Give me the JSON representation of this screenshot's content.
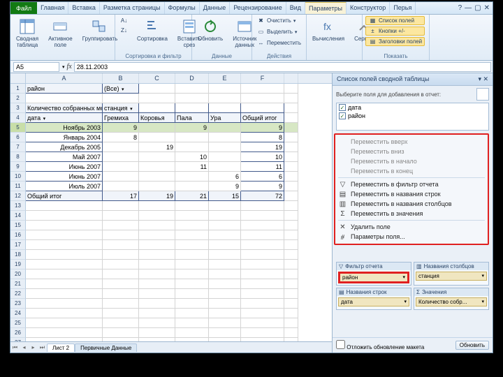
{
  "tabs": {
    "file": "Файл",
    "home": "Главная",
    "insert": "Вставка",
    "layout": "Разметка страницы",
    "formulas": "Формулы",
    "data": "Данные",
    "review": "Рецензирование",
    "view": "Вид",
    "options": "Параметры",
    "design": "Конструктор",
    "addon": "Перья"
  },
  "ribbon": {
    "g1": {
      "pivot": "Сводная\nтаблица",
      "active": "Активное\nполе",
      "group": "Группировать"
    },
    "g2": {
      "title": "Сортировка и фильтр",
      "sort": "Сортировка",
      "insert": "Вставить\nсрез"
    },
    "g3": {
      "title": "Данные",
      "refresh": "Обновить",
      "source": "Источник\nданных"
    },
    "g4": {
      "title": "Действия",
      "clear": "Очистить",
      "select": "Выделить",
      "move": "Переместить"
    },
    "g5": {
      "calc": "Вычисления",
      "tools": "Сервис"
    },
    "g6": {
      "title": "Показать",
      "fields": "Список полей",
      "buttons": "Кнопки +/-",
      "headers": "Заголовки полей"
    }
  },
  "fbar": {
    "name": "A5",
    "formula": "28.11.2003"
  },
  "grid": {
    "cols": [
      "A",
      "B",
      "C",
      "D",
      "E",
      "F"
    ],
    "a1": "район",
    "b1": "(Все)",
    "a3": "Количество собранных моллюсков",
    "b3": "станция",
    "a4": "дата",
    "b4": "Гремиха",
    "c4": "Коровья",
    "d4": "Пала",
    "e4": "Ура",
    "f4": "Общий итог",
    "r": [
      {
        "a": "Ноябрь 2003",
        "b": "9",
        "c": "",
        "d": "9",
        "e": "",
        "f": "9"
      },
      {
        "a": "Январь 2004",
        "b": "8",
        "c": "",
        "d": "",
        "e": "",
        "f": "8"
      },
      {
        "a": "Декабрь 2005",
        "b": "",
        "c": "19",
        "d": "",
        "e": "",
        "f": "19"
      },
      {
        "a": "Май 2007",
        "b": "",
        "c": "",
        "d": "10",
        "e": "",
        "f": "10"
      },
      {
        "a": "Июнь 2007",
        "b": "",
        "c": "",
        "d": "11",
        "e": "",
        "f": "11"
      },
      {
        "a": "Июнь 2007",
        "b": "",
        "c": "",
        "d": "",
        "e": "6",
        "f": "6"
      },
      {
        "a": "Июль 2007",
        "b": "",
        "c": "",
        "d": "",
        "e": "9",
        "f": "9"
      }
    ],
    "tot": {
      "a": "Общий итог",
      "b": "17",
      "c": "19",
      "d": "21",
      "e": "15",
      "f": "72"
    }
  },
  "sheets": {
    "s1": "Лист 2",
    "s2": "Первичные Данные"
  },
  "pane": {
    "title": "Список полей сводной таблицы",
    "sub": "Выберите поля для добавления в отчет:",
    "fields": {
      "f1": "дата",
      "f2": "район"
    },
    "menu": {
      "up": "Переместить вверх",
      "down": "Переместить вниз",
      "begin": "Переместить в начало",
      "end": "Переместить в конец",
      "filter": "Переместить в фильтр отчета",
      "rows": "Переместить в названия строк",
      "cols": "Переместить в названия столбцов",
      "vals": "Переместить в значения",
      "del": "Удалить поле",
      "opts": "Параметры поля..."
    },
    "zones": {
      "filter_h": "Фильтр отчета",
      "filter_chip": "район",
      "cols_h": "Названия столбцов",
      "cols_chip": "станция",
      "rows_h": "Названия строк",
      "rows_chip": "дата",
      "vals_h": "Значения",
      "vals_chip": "Количество собр..."
    },
    "foot": {
      "defer": "Отложить обновление макета",
      "update": "Обновить"
    }
  }
}
